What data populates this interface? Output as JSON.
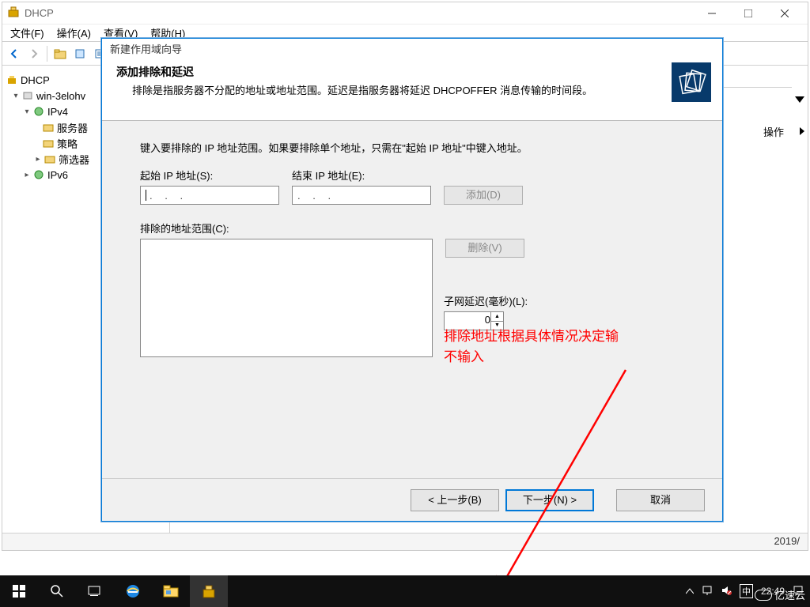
{
  "mainWindow": {
    "title": "DHCP",
    "menubar": {
      "file": "文件(F)",
      "action": "操作(A)",
      "view": "查看(V)",
      "help": "帮助(H)"
    },
    "tree": {
      "root": "DHCP",
      "server": "win-3elohv",
      "ipv4": "IPv4",
      "serverOptions": "服务器",
      "policies": "策略",
      "filters": "筛选器",
      "ipv6": "IPv6"
    },
    "right": {
      "op": "操作"
    },
    "status": {
      "date": "2019/"
    }
  },
  "wizard": {
    "windowTitle": "新建作用域向导",
    "headerTitle": "添加排除和延迟",
    "headerDesc": "排除是指服务器不分配的地址或地址范围。延迟是指服务器将延迟 DHCPOFFER 消息传输的时间段。",
    "hint": "键入要排除的 IP 地址范围。如果要排除单个地址，只需在\"起始 IP 地址\"中键入地址。",
    "startIpLabel": "起始 IP 地址(S):",
    "endIpLabel": "结束 IP 地址(E):",
    "startIpValue": "  .   .   .   ",
    "endIpValue": "  .   .   .   ",
    "addBtn": "添加(D)",
    "excludedLabel": "排除的地址范围(C):",
    "deleteBtn": "删除(V)",
    "delayLabel": "子网延迟(毫秒)(L):",
    "delayValue": "0",
    "annotation1": "排除地址根据具体情况决定输",
    "annotation2": "不输入",
    "backBtn": "< 上一步(B)",
    "nextBtn": "下一步(N) >",
    "cancelBtn": "取消"
  },
  "taskbar": {
    "time": "22:49"
  },
  "watermark": "亿速云"
}
